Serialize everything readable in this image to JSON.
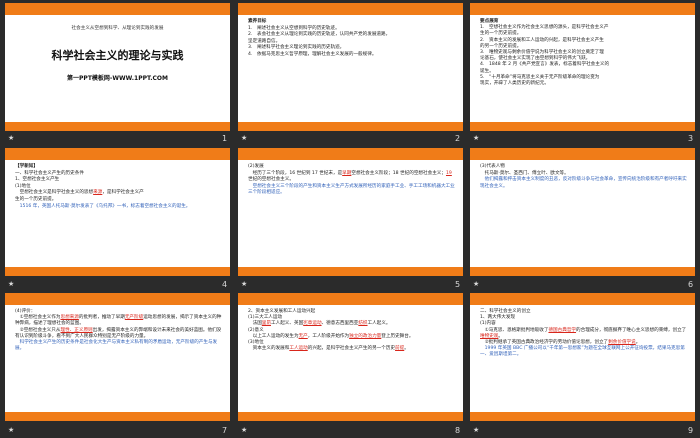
{
  "slides": [
    {
      "number": "1",
      "subtitle": "社会主义从空想到科学、从理论到实践的发展",
      "title": "科学社会主义的理论与实践",
      "site": "第一PPT模板网-WWW.1PPT.COM"
    },
    {
      "number": "2",
      "heading": "素养目标",
      "lines": [
        "1.　阐述社会主义从空想到科学的历史轨迹。",
        "2.　表会社会主义从理论到实践的历史轨迹，认同共产党的发展道路，",
        "坚定道路自信。",
        "3.　阐述科学社会主义理论到实践的历史轨迹。",
        "4.　依据马克思主义哲学原理，理解社会主义发展的一般规律。"
      ]
    },
    {
      "number": "3",
      "heading": "要点展育",
      "lines": [
        "1.　空想社会主义作为社会主义思想的源头，是科学社会主义产",
        "生的一个历史前提。",
        "2.　资本主义的发展和工人运动的兴起，是科学社会主义产生",
        "的另一个历史前提。",
        "3.　唯物史观与剩余价值学说为科学社会主义的创立奠定了理",
        "论基石，使社会主义实现了由空想到科学的伟大飞跃。",
        "4.　1848 年 2 月《共产党宣言》发表，标志着科学社会主义的",
        "诞生。",
        "5.　“十月革命”将马克思主义关于无产阶级革命的理论变为",
        "现实，开辟了人类历史的新纪元。"
      ]
    },
    {
      "number": "4",
      "tag": "【学新知】",
      "line1": "一、科学社会主义产生的历史条件",
      "line2": "1、空想社会主义产生",
      "line3": "(1)地位",
      "p1a": "空想社会主义是科学社会主义的思想",
      "p1red": "来源",
      "p1b": "，是科学社会主义产",
      "p1c": "生的一个历史前提。",
      "p2": "1516 年，英国人托马斯·莫尔发表了《乌托邦》一书，标志着空想社会主义的诞生。"
    },
    {
      "number": "5",
      "line1": "(2)发展",
      "p1a": "经历了三个阶段，16 世纪到 17 世纪末，是",
      "p1red": "早期",
      "p1b": "空想社会主义",
      "p1c": "阶段；18 世纪的空想社会主义；",
      "p1red2": "19",
      "p1d": " 世纪的空想社会主义。",
      "p2": "空想社会主义三个阶段的产生和资本主义生产方式发展所经历的家庭手工业、手工工场和机器大工业三个阶段相适应。"
    },
    {
      "number": "6",
      "line1": "(3)代表人物",
      "line2": "托马斯·莫尔、圣西门、傅立叶、欧文等。",
      "p": "他们揭露和抨击资本主义制度的丑恶，反对阶级斗争与社会革命，宣传向统治阶级和有产者呼吁来实现社会主义。"
    },
    {
      "number": "7",
      "line1": "(4)评价：",
      "p1a": "①空想社会主义作为",
      "p1red": "思想来源",
      "p1b": "的批判者，推动了早期",
      "p1red2": "无产阶级",
      "p1c": "运动思想的发展，揭示了资本主义的种种弊病，描述了理想社会的蓝图。",
      "p2a": "②空想社会主义只从",
      "p2red": "理性、正义原则",
      "p2b": "出发，揭露资本主义的弊端和设计未来社会的美好蓝图。他们没有认识到阶级斗争，看不到广大人民群众特别是无产阶级的力量。",
      "p3": "科学社会主义产生的历史条件是社会化大生产与资本主义私有制的矛盾运动，无产阶级的产生与发展。"
    },
    {
      "number": "8",
      "line1": "2、资本主义发展和工人运动兴起",
      "line2": "(1)三大工人运动",
      "p1a": "法国",
      "p1red": "里昂",
      "p1b": "工人起义、英国",
      "p1red2": "宪章运动",
      "p1c": "、德意志西里西亚",
      "p1red3": "纺织",
      "p1d": "工人起义。",
      "line3": "(2)意义",
      "p2a": "以上工人运动的发生为",
      "p2red": "无产",
      "p2b": "，工人阶级开始作为",
      "p2red2": "独立的政治力量",
      "p2c": "登上历史舞台。",
      "line4": "(3)地位",
      "p3a": "资本主义的发展和",
      "p3red": "工人运动",
      "p3b": "的兴起，是科学社会主义产生的另一个历史",
      "p3red2": "前提",
      "p3c": "。"
    },
    {
      "number": "9",
      "line1": "二、科学社会主义的创立",
      "line2": "1、两大伟大发现",
      "line3": "(1)内容",
      "p1a": "①马克思、恩格斯批判地吸收了",
      "p1red": "德国古典哲学",
      "p1b": "的合理成分，彻底摒弃了唯心主义思想的束缚，创立了",
      "p1red2": "唯物史观",
      "p1c": "。",
      "p2a": "②批判继承了英国古典政治经济学的劳动价值论思想，创立了",
      "p2red": "剩余价值学说",
      "p2b": "。",
      "p3": "1999 年英国 BBC 广播公司以“千年第一思想家”为题在全球互联网上公开征询投票，结果马克思第一、爱因斯坦第二。"
    }
  ]
}
